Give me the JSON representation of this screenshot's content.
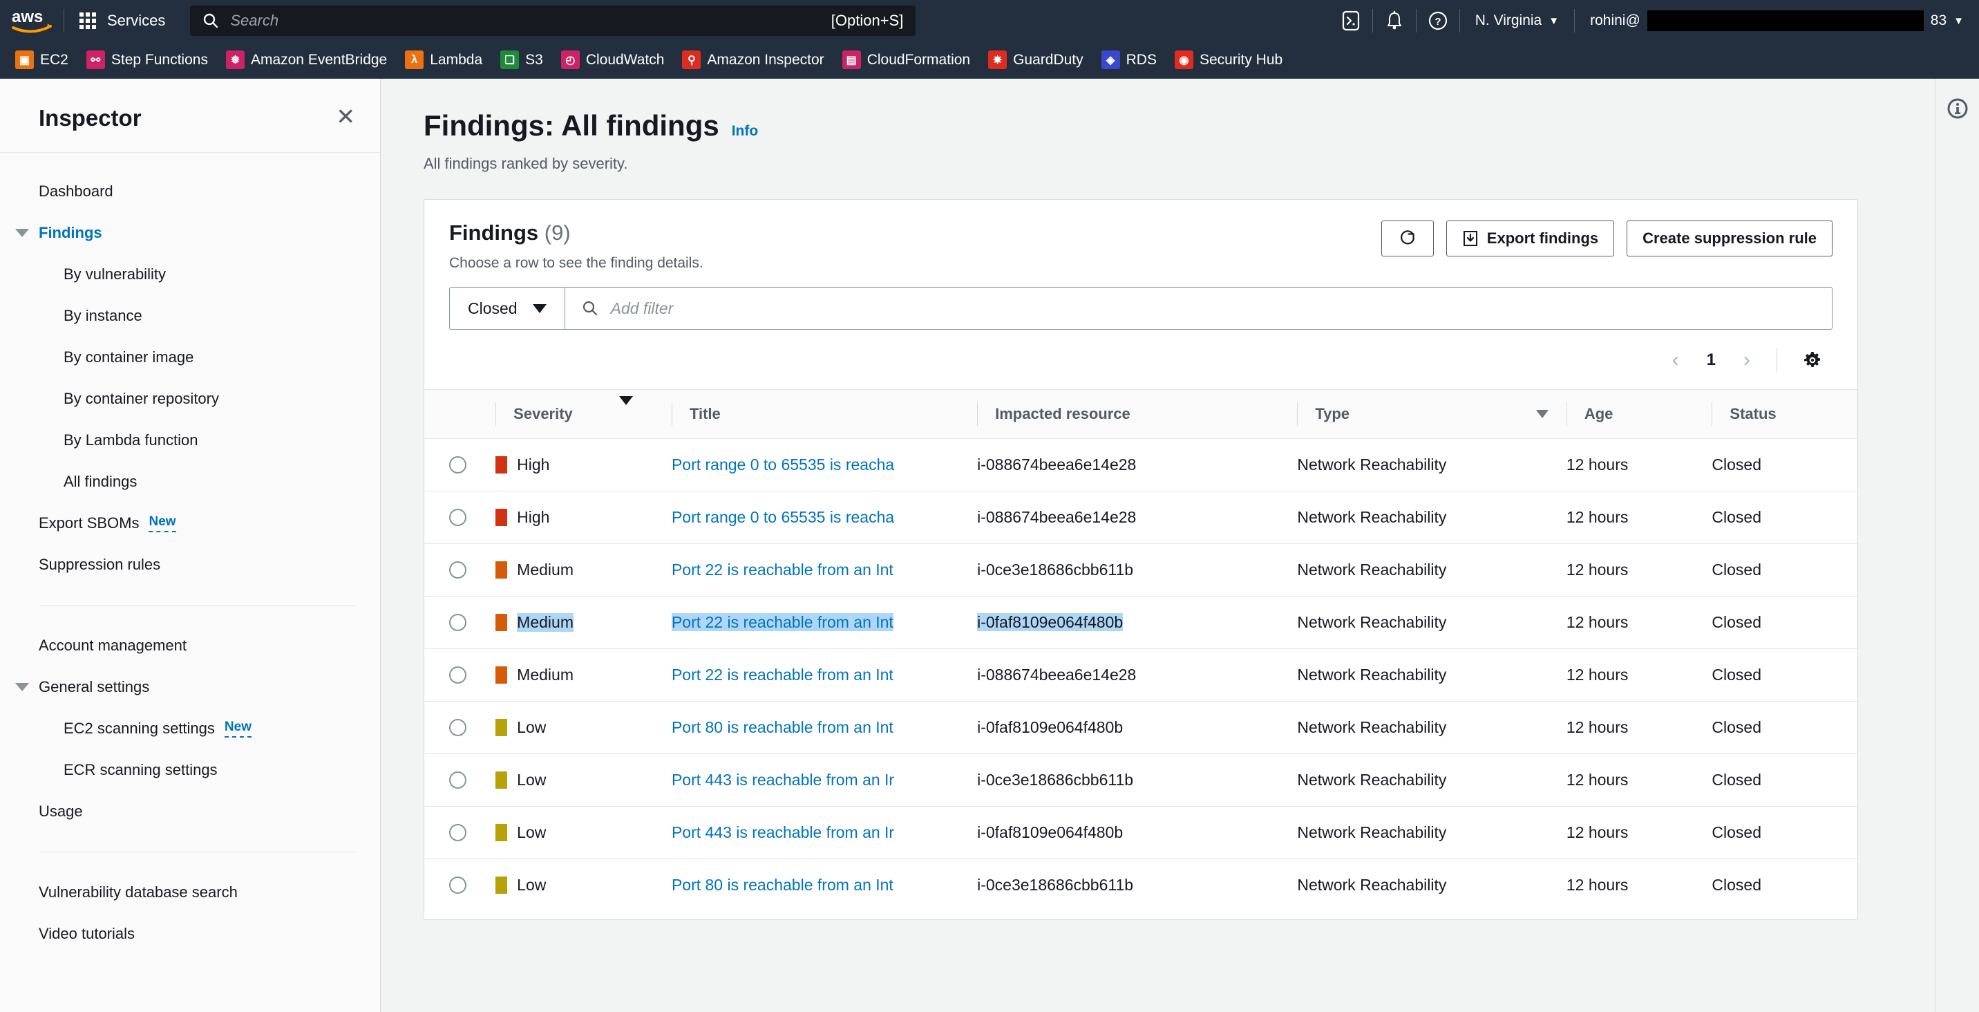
{
  "topnav": {
    "logo_icon": "aws-logo",
    "waffle_icon": "waffle-grid-icon",
    "services_label": "Services",
    "search": {
      "icon": "search-icon",
      "placeholder": "Search",
      "shortcut": "[Option+S]"
    },
    "cloudshell_icon": "cloudshell-icon",
    "notifications_icon": "bell-icon",
    "help_icon": "question-circle-icon",
    "region_label": "N. Virginia",
    "account_label": "rohini@",
    "account_suffix": "83",
    "caret_icon": "caret-down-icon"
  },
  "favorites": [
    {
      "label": "EC2",
      "icon": "ec2-icon",
      "color": "#ec7211"
    },
    {
      "label": "Step Functions",
      "icon": "step-functions-icon",
      "color": "#cd2264"
    },
    {
      "label": "Amazon EventBridge",
      "icon": "eventbridge-icon",
      "color": "#cd2264"
    },
    {
      "label": "Lambda",
      "icon": "lambda-icon",
      "color": "#ec7211"
    },
    {
      "label": "S3",
      "icon": "s3-icon",
      "color": "#1f8a3c"
    },
    {
      "label": "CloudWatch",
      "icon": "cloudwatch-icon",
      "color": "#cd2264"
    },
    {
      "label": "Amazon Inspector",
      "icon": "inspector-icon",
      "color": "#e02b20"
    },
    {
      "label": "CloudFormation",
      "icon": "cloudformation-icon",
      "color": "#cd2264"
    },
    {
      "label": "GuardDuty",
      "icon": "guardduty-icon",
      "color": "#e02b20"
    },
    {
      "label": "RDS",
      "icon": "rds-icon",
      "color": "#3b48cc"
    },
    {
      "label": "Security Hub",
      "icon": "security-hub-icon",
      "color": "#e02b20"
    }
  ],
  "sidebar": {
    "title": "Inspector",
    "close_icon": "close-icon",
    "items": [
      {
        "label": "Dashboard",
        "level": 0,
        "active": false,
        "expandable": false
      },
      {
        "label": "Findings",
        "level": 0,
        "active": true,
        "expandable": true
      },
      {
        "label": "By vulnerability",
        "level": 1,
        "active": false,
        "expandable": false
      },
      {
        "label": "By instance",
        "level": 1,
        "active": false,
        "expandable": false
      },
      {
        "label": "By container image",
        "level": 1,
        "active": false,
        "expandable": false
      },
      {
        "label": "By container repository",
        "level": 1,
        "active": false,
        "expandable": false
      },
      {
        "label": "By Lambda function",
        "level": 1,
        "active": false,
        "expandable": false
      },
      {
        "label": "All findings",
        "level": 1,
        "active": false,
        "expandable": false
      },
      {
        "label": "Export SBOMs",
        "level": 0,
        "active": false,
        "expandable": false,
        "badge": "New"
      },
      {
        "label": "Suppression rules",
        "level": 0,
        "active": false,
        "expandable": false
      }
    ],
    "items2": [
      {
        "label": "Account management",
        "level": 0,
        "active": false,
        "expandable": false
      },
      {
        "label": "General settings",
        "level": 0,
        "active": false,
        "expandable": true
      },
      {
        "label": "EC2 scanning settings",
        "level": 1,
        "active": false,
        "expandable": false,
        "badge": "New"
      },
      {
        "label": "ECR scanning settings",
        "level": 1,
        "active": false,
        "expandable": false
      },
      {
        "label": "Usage",
        "level": 0,
        "active": false,
        "expandable": false
      }
    ],
    "items3": [
      {
        "label": "Vulnerability database search",
        "level": 0,
        "active": false,
        "expandable": false
      },
      {
        "label": "Video tutorials",
        "level": 0,
        "active": false,
        "expandable": false
      }
    ]
  },
  "page": {
    "title": "Findings: All findings",
    "info_label": "Info",
    "subtitle": "All findings ranked by severity.",
    "info_rail_icon": "info-circle-icon"
  },
  "card": {
    "title": "Findings",
    "count": "(9)",
    "subtitle": "Choose a row to see the finding details.",
    "refresh_icon": "refresh-icon",
    "export_icon": "download-icon",
    "export_label": "Export findings",
    "suppression_label": "Create suppression rule"
  },
  "filter": {
    "select_value": "Closed",
    "select_caret_icon": "caret-down-icon",
    "search_icon": "search-icon",
    "placeholder": "Add filter"
  },
  "pagination": {
    "prev_icon": "chevron-left-icon",
    "page": "1",
    "next_icon": "chevron-right-icon",
    "settings_icon": "gear-icon"
  },
  "table": {
    "columns": [
      {
        "key": "select",
        "label": ""
      },
      {
        "key": "severity",
        "label": "Severity",
        "sort": "solid-down"
      },
      {
        "key": "title",
        "label": "Title"
      },
      {
        "key": "resource",
        "label": "Impacted resource"
      },
      {
        "key": "type",
        "label": "Type",
        "sort": "hollow-down"
      },
      {
        "key": "age",
        "label": "Age"
      },
      {
        "key": "status",
        "label": "Status"
      }
    ],
    "severity_colors": {
      "High": "#d13212",
      "Medium": "#d45b07",
      "Low": "#b8a20a"
    },
    "selection_highlight_color": "#aed6f7",
    "rows": [
      {
        "severity": "High",
        "title": "Port range 0 to 65535 is reacha",
        "resource": "i-088674beea6e14e28",
        "type": "Network Reachability",
        "age": "12 hours",
        "status": "Closed",
        "selected": false
      },
      {
        "severity": "High",
        "title": "Port range 0 to 65535 is reacha",
        "resource": "i-088674beea6e14e28",
        "type": "Network Reachability",
        "age": "12 hours",
        "status": "Closed",
        "selected": false
      },
      {
        "severity": "Medium",
        "title": "Port 22 is reachable from an Int",
        "resource": "i-0ce3e18686cbb611b",
        "type": "Network Reachability",
        "age": "12 hours",
        "status": "Closed",
        "selected": false
      },
      {
        "severity": "Medium",
        "title": "Port 22 is reachable from an Int",
        "resource": "i-0faf8109e064f480b",
        "type": "Network Reachability",
        "age": "12 hours",
        "status": "Closed",
        "selected": true
      },
      {
        "severity": "Medium",
        "title": "Port 22 is reachable from an Int",
        "resource": "i-088674beea6e14e28",
        "type": "Network Reachability",
        "age": "12 hours",
        "status": "Closed",
        "selected": false
      },
      {
        "severity": "Low",
        "title": "Port 80 is reachable from an Int",
        "resource": "i-0faf8109e064f480b",
        "type": "Network Reachability",
        "age": "12 hours",
        "status": "Closed",
        "selected": false
      },
      {
        "severity": "Low",
        "title": "Port 443 is reachable from an Ir",
        "resource": "i-0ce3e18686cbb611b",
        "type": "Network Reachability",
        "age": "12 hours",
        "status": "Closed",
        "selected": false
      },
      {
        "severity": "Low",
        "title": "Port 443 is reachable from an Ir",
        "resource": "i-0faf8109e064f480b",
        "type": "Network Reachability",
        "age": "12 hours",
        "status": "Closed",
        "selected": false
      },
      {
        "severity": "Low",
        "title": "Port 80 is reachable from an Int",
        "resource": "i-0ce3e18686cbb611b",
        "type": "Network Reachability",
        "age": "12 hours",
        "status": "Closed",
        "selected": false
      }
    ]
  }
}
